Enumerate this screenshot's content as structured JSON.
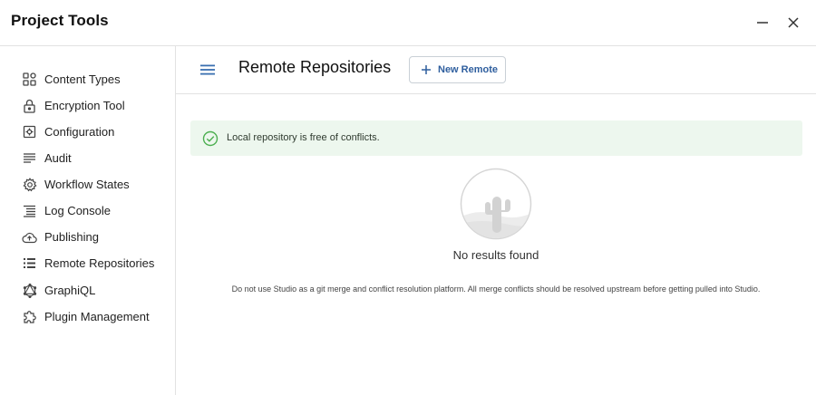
{
  "window": {
    "title": "Project Tools",
    "minimize_icon": "minus-icon",
    "close_icon": "close-icon"
  },
  "sidebar": {
    "items": [
      {
        "label": "Content Types",
        "icon": "content-types-icon"
      },
      {
        "label": "Encryption Tool",
        "icon": "lock-icon"
      },
      {
        "label": "Configuration",
        "icon": "configuration-icon"
      },
      {
        "label": "Audit",
        "icon": "audit-lines-icon"
      },
      {
        "label": "Workflow States",
        "icon": "gear-icon"
      },
      {
        "label": "Log Console",
        "icon": "log-console-icon"
      },
      {
        "label": "Publishing",
        "icon": "cloud-upload-icon"
      },
      {
        "label": "Remote Repositories",
        "icon": "list-icon"
      },
      {
        "label": "GraphiQL",
        "icon": "graphql-icon"
      },
      {
        "label": "Plugin Management",
        "icon": "puzzle-icon"
      }
    ]
  },
  "main": {
    "title": "Remote Repositories",
    "new_remote_label": "New Remote",
    "alert": {
      "message": "Local repository is free of conflicts.",
      "color": "#edf7ee",
      "icon_color": "#4caf50"
    },
    "empty_state": {
      "text": "No results found",
      "icon": "cactus-empty-illustration"
    },
    "note": "Do not use Studio as a git merge and conflict resolution platform. All merge conflicts should be resolved upstream before getting pulled into Studio."
  },
  "colors": {
    "accent": "#2e5e9e",
    "menu_icon": "#3a6fb0",
    "border": "#e2e2e2"
  }
}
